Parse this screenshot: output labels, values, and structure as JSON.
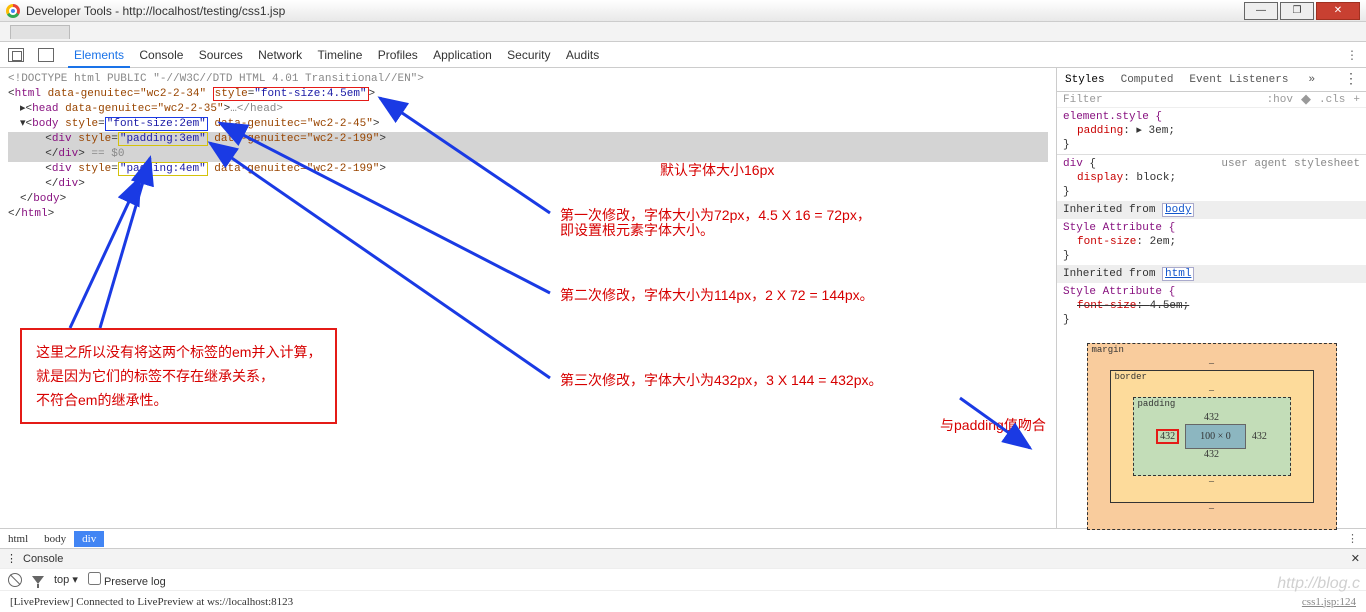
{
  "window": {
    "title": "Developer Tools - http://localhost/testing/css1.jsp"
  },
  "tabs": [
    "Elements",
    "Console",
    "Sources",
    "Network",
    "Timeline",
    "Profiles",
    "Application",
    "Security",
    "Audits"
  ],
  "dom": {
    "doctype": "<!DOCTYPE html PUBLIC \"-//W3C//DTD HTML 4.01 Transitional//EN\">",
    "html_attr": "data-genuitec=\"wc2-2-34\"",
    "html_style": "style=\"font-size:4.5em\"",
    "head_attr": "data-genuitec=\"wc2-2-35\"",
    "head_ell": "…</head>",
    "body_style": "\"font-size:2em\"",
    "body_attr": "data-genuitec=\"wc2-2-45\"",
    "div1_style": "\"padding:3em\"",
    "div1_attr": "data-genuitec=\"wc2-2-199\"",
    "eq0": "== $0",
    "div2_style": "\"padding:4em\"",
    "div2_attr": "data-genuitec=\"wc2-2-199\""
  },
  "annotations": {
    "a0": "默认字体大小16px",
    "a1": "第一次修改，字体大小为72px，4.5 X 16 = 72px，",
    "a1b": "即设置根元素字体大小。",
    "a2": "第二次修改，字体大小为114px，2 X 72 = 144px。",
    "a3": "第三次修改，字体大小为432px，3 X 144 = 432px。",
    "a4": "与padding值吻合",
    "box1": "这里之所以没有将这两个标签的em并入计算，",
    "box2": "就是因为它们的标签不存在继承关系，",
    "box3": "不符合em的继承性。"
  },
  "styles": {
    "tabs": [
      "Styles",
      "Computed",
      "Event Listeners"
    ],
    "filter_ph": "Filter",
    "pills": [
      ":hov",
      ".cls",
      "+"
    ],
    "rules": {
      "el_style": "element.style {",
      "padding": "padding: ▸ 3em;",
      "div": "div {",
      "ua": "user agent stylesheet",
      "display": "display: block;",
      "inh_body": "Inherited from",
      "body": "body",
      "sa": "Style Attribute {",
      "fs2": "font-size: 2em;",
      "inh_html": "Inherited from",
      "html": "html",
      "fs45": "font-size: 4.5em;"
    }
  },
  "boxmodel": {
    "margin": "margin",
    "mdash": "–",
    "border": "border",
    "padding": "padding",
    "ptop": "432",
    "pleft": "432",
    "pright": "432",
    "pbot": "432",
    "content": "100 × 0"
  },
  "breadcrumb": [
    "html",
    "body",
    "div"
  ],
  "console": {
    "label": "Console",
    "top": "top",
    "preserve": "Preserve log",
    "msg": "[LivePreview] Connected to LivePreview at ws://localhost:8123",
    "src": "css1.jsp:124"
  },
  "watermark": "http://blog.c"
}
